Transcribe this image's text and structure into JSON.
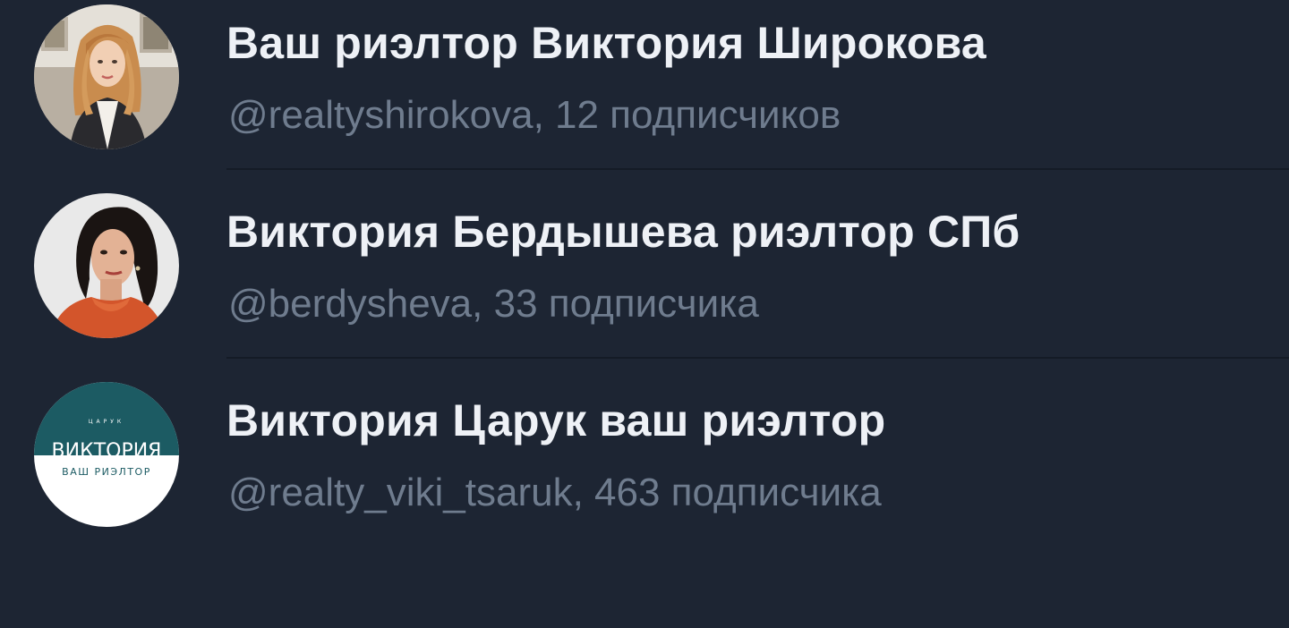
{
  "results": [
    {
      "title": "Ваш риэлтор Виктория Широкова",
      "subtitle": "@realtyshirokova, 12 подписчиков",
      "avatar_icon": "photo-woman-blonde"
    },
    {
      "title": "Виктория Бердышева риэлтор СПб",
      "subtitle": "@berdysheva, 33 подписчика",
      "avatar_icon": "photo-woman-dark-hair"
    },
    {
      "title": "Виктория Царук ваш риэлтор",
      "subtitle": "@realty_viki_tsaruk, 463 подписчика",
      "avatar_icon": "logo",
      "logo": {
        "top": "ЦАРУК",
        "main": "ВИКТОРИЯ",
        "bottom": "ВАШ РИЭЛТОР"
      }
    }
  ],
  "colors": {
    "background": "#1d2533",
    "title": "#eef1f6",
    "subtitle": "#6f7c8e",
    "logo_teal": "#1c5b63"
  }
}
